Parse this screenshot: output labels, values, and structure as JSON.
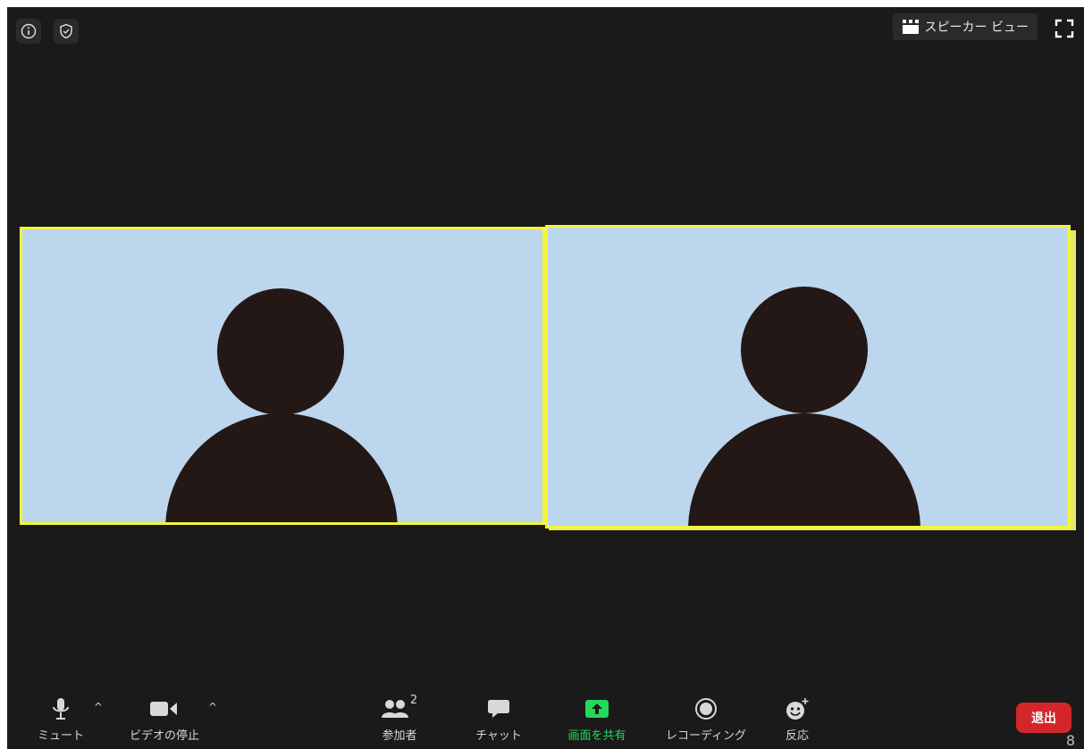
{
  "view": {
    "label": "スピーカー ビュー"
  },
  "toolbar": {
    "mute": {
      "label": "ミュート"
    },
    "video": {
      "label": "ビデオの停止"
    },
    "participants": {
      "label": "参加者",
      "count": "2"
    },
    "chat": {
      "label": "チャット"
    },
    "share": {
      "label": "画面を共有"
    },
    "record": {
      "label": "レコーディング"
    },
    "reactions": {
      "label": "反応"
    },
    "leave": {
      "label": "退出"
    }
  },
  "corner_number": "8",
  "colors": {
    "background": "#1a1a1a",
    "tile": "#bcd6ee",
    "tile_border": "#f2f53a",
    "avatar": "#231816",
    "share_green": "#23d959",
    "leave_red": "#d2262b"
  }
}
